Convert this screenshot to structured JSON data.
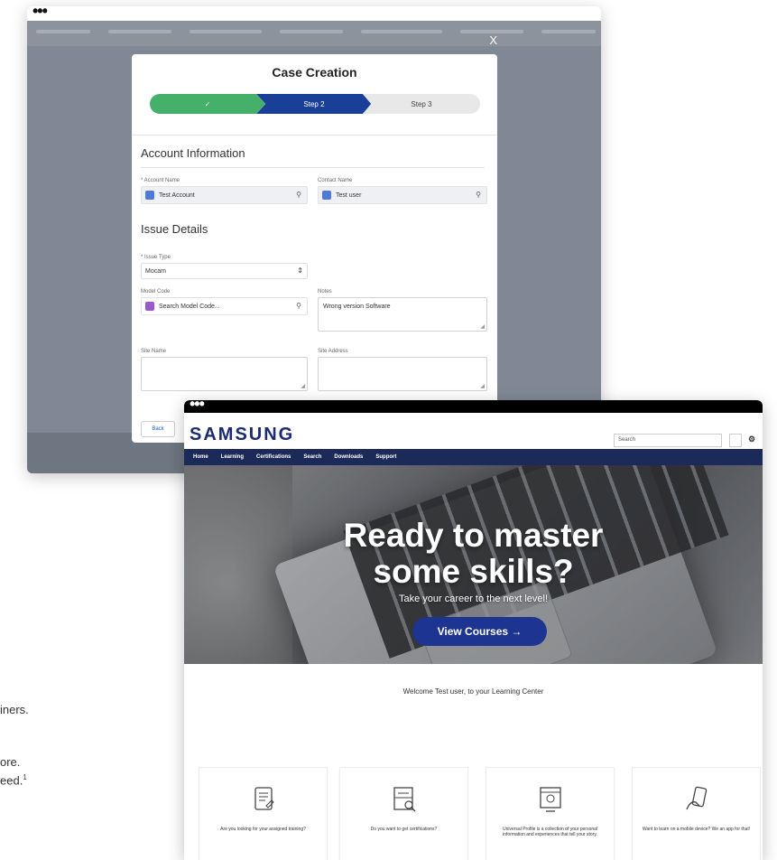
{
  "left_text": {
    "line1": "iners.",
    "line2": "ore.",
    "line3": "eed.",
    "line3_sup": "1"
  },
  "case_window": {
    "close_label": "X",
    "modal_title": "Case Creation",
    "path": {
      "step1_label": "✓",
      "step2_label": "Step 2",
      "step3_label": "Step 3"
    },
    "account_section": "Account Information",
    "account_name_label": "* Account Name",
    "account_name_value": "Test Account",
    "contact_name_label": "Contact Name",
    "contact_name_value": "Test user",
    "issue_section": "Issue Details",
    "issue_type_label": "* Issue Type",
    "issue_type_value": "Mocam",
    "model_code_label": "Model Code",
    "model_code_placeholder": "Search Model Code...",
    "notes_label": "Notes",
    "notes_value": "Wrong version Software",
    "site_name_label": "Site Name",
    "site_address_label": "Site Address",
    "back_button": "Back",
    "colors": {
      "complete": "#45b06a",
      "current": "#1a3f97",
      "lookup_account": "#4f79d8",
      "lookup_contact": "#4f79d8",
      "lookup_model": "#9b59d0"
    }
  },
  "samsung_window": {
    "logo": "SAMSUNG",
    "search_placeholder": "Search",
    "nav": [
      "Home",
      "Learning",
      "Certifications",
      "Search",
      "Downloads",
      "Support"
    ],
    "hero_title_line1": "Ready to master",
    "hero_title_line2": "some skills?",
    "hero_subtitle": "Take your career to the next level!",
    "cta_label": "View Courses →",
    "welcome": "Welcome Test user, to your Learning Center",
    "cards": [
      {
        "icon": "document-icon",
        "text": "Are you looking for your assigned training?"
      },
      {
        "icon": "certificate-search-icon",
        "text": "Do you want to get certifications?"
      },
      {
        "icon": "profile-monitor-icon",
        "text": "Universal Profile is a collection of your personal information and experiences that tell your story."
      },
      {
        "icon": "mobile-hand-icon",
        "text": "Want to learn on a mobile device? We an app for that!"
      }
    ],
    "brand_color": "#1b2a73",
    "nav_color": "#1b2a58",
    "cta_color": "#1d3591"
  }
}
